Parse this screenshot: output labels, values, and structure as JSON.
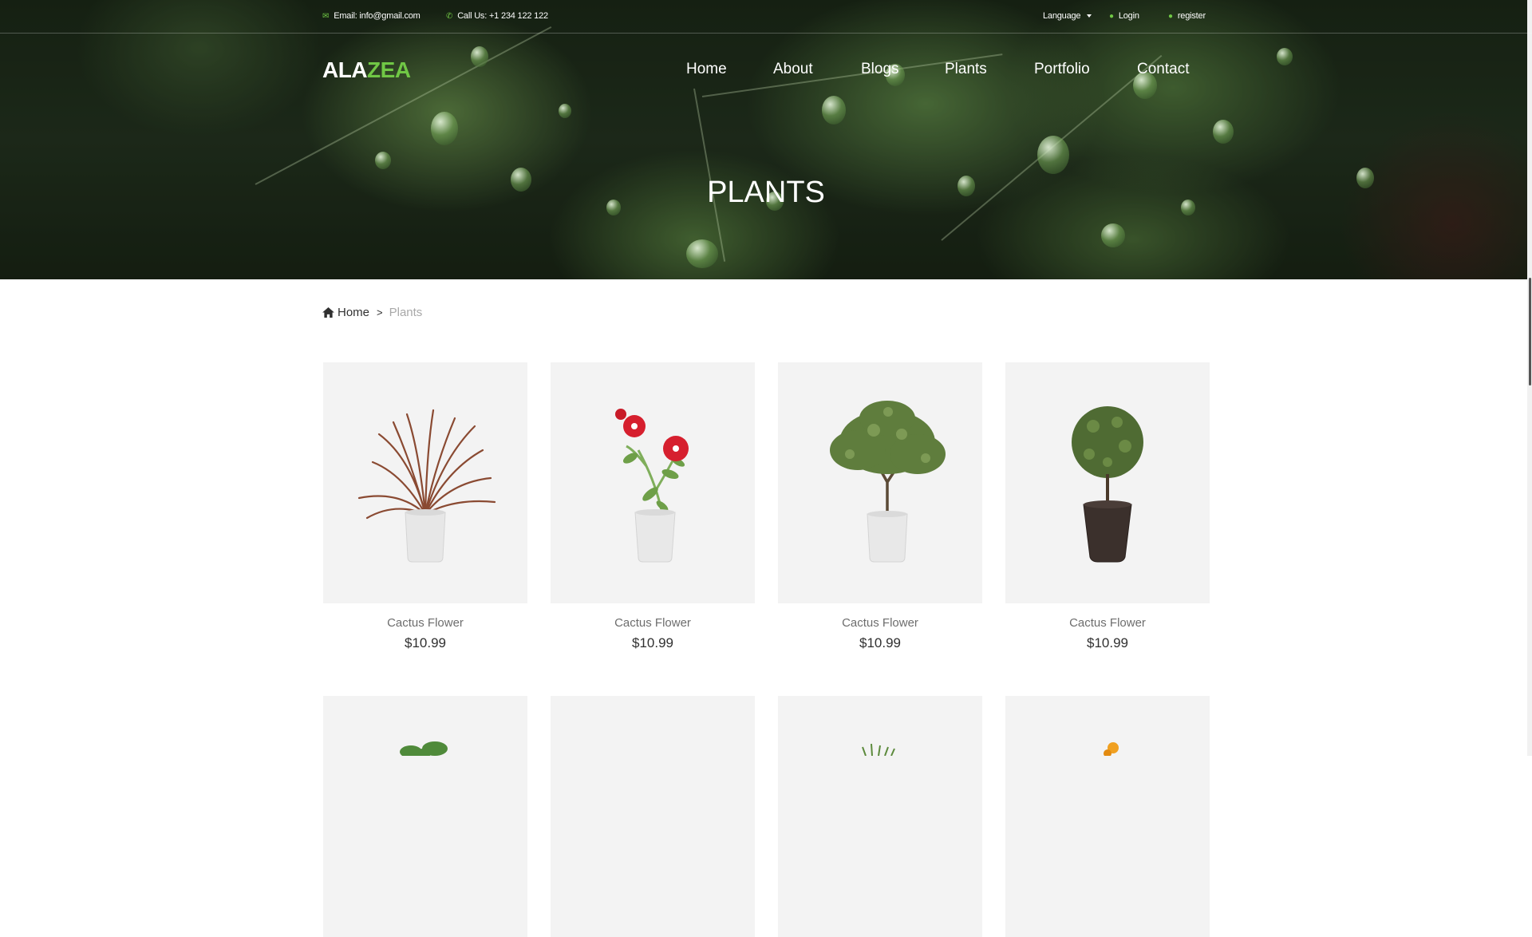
{
  "topbar": {
    "email_label": "Email: info@gmail.com",
    "phone_label": "Call Us: +1 234 122 122",
    "language_label": "Language",
    "login_label": "Login",
    "register_label": "register"
  },
  "brand": {
    "logo_part1": "ALA",
    "logo_part2": "ZEA",
    "accent_color": "#70c745"
  },
  "nav": {
    "items": [
      "Home",
      "About",
      "Blogs",
      "Plants",
      "Portfolio",
      "Contact"
    ]
  },
  "hero": {
    "title": "PLANTS"
  },
  "breadcrumb": {
    "home": "Home",
    "separator": ">",
    "current": "Plants"
  },
  "products": [
    {
      "name": "Cactus Flower",
      "price": "$10.99",
      "icon": "dracaena-plant"
    },
    {
      "name": "Cactus Flower",
      "price": "$10.99",
      "icon": "red-flower-plant"
    },
    {
      "name": "Cactus Flower",
      "price": "$10.99",
      "icon": "olive-tree-plant"
    },
    {
      "name": "Cactus Flower",
      "price": "$10.99",
      "icon": "topiary-plant"
    }
  ]
}
